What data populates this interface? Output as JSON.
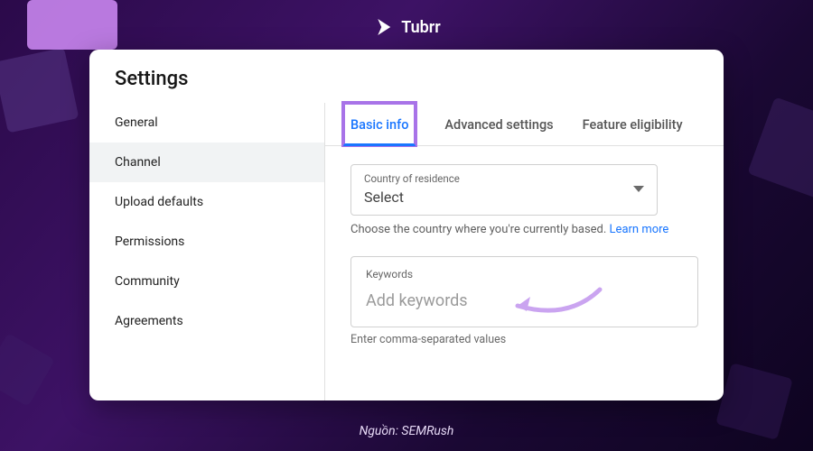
{
  "brand": "Tubrr",
  "source": "Nguồn: SEMRush",
  "title": "Settings",
  "sidebar": {
    "items": [
      {
        "label": "General"
      },
      {
        "label": "Channel"
      },
      {
        "label": "Upload defaults"
      },
      {
        "label": "Permissions"
      },
      {
        "label": "Community"
      },
      {
        "label": "Agreements"
      }
    ],
    "active_index": 1
  },
  "tabs": {
    "items": [
      {
        "label": "Basic info"
      },
      {
        "label": "Advanced settings"
      },
      {
        "label": "Feature eligibility"
      }
    ],
    "active_index": 0
  },
  "country": {
    "label": "Country of residence",
    "value": "Select",
    "helper": "Choose the country where you're currently based. ",
    "learn_more": "Learn more"
  },
  "keywords": {
    "label": "Keywords",
    "placeholder": "Add keywords",
    "helper": "Enter comma-separated values"
  }
}
